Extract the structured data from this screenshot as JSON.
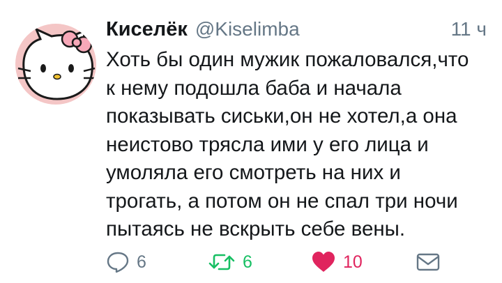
{
  "author": {
    "display_name": "Киселёк",
    "handle": "@Kiselimba",
    "avatar": "hello-kitty-avatar"
  },
  "timestamp": "11 ч",
  "tweet": {
    "lines": [
      "Хоть бы один мужик пожаловался,что",
      "к нему подошла баба и начала",
      "показывать сиськи,он не хотел,а она",
      "неистово трясла ими у его лица и",
      "умоляла его смотреть на них и",
      "трогать, а потом он не спал три ночи",
      "пытаясь не вскрыть себе вены."
    ]
  },
  "actions": {
    "reply": {
      "icon": "reply-icon",
      "count": "6"
    },
    "retweet": {
      "icon": "retweet-icon",
      "count": "6",
      "color": "#17bf63"
    },
    "like": {
      "icon": "heart-icon",
      "count": "10",
      "color": "#e0245e",
      "liked": true
    },
    "dm": {
      "icon": "envelope-icon"
    }
  },
  "colors": {
    "text": "#14171a",
    "secondary": "#657786",
    "avatar_background": "#f4c6c6"
  }
}
